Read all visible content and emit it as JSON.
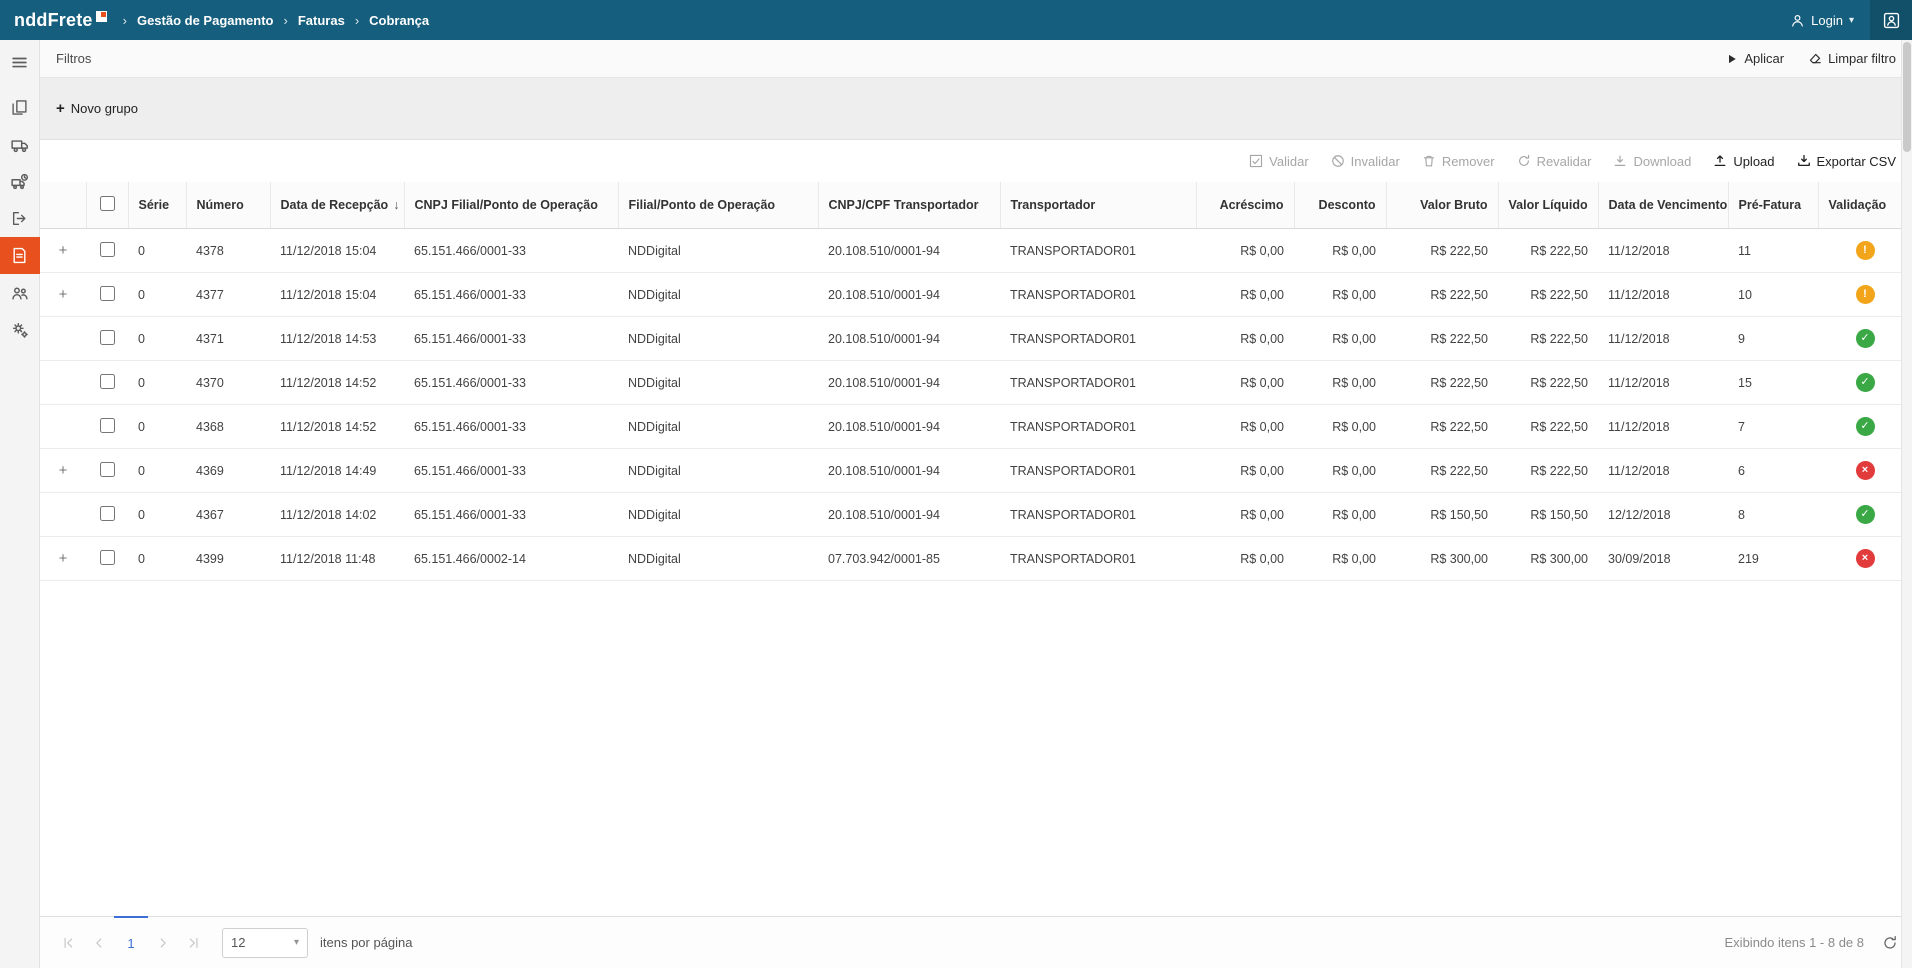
{
  "topbar": {
    "logo": "nddFrete",
    "breadcrumb": [
      "Gestão de Pagamento",
      "Faturas",
      "Cobrança"
    ],
    "login_label": "Login"
  },
  "icons": {
    "expand": "+",
    "plus": "+",
    "caret_down": "▾",
    "sort_desc": "↓",
    "breadcrumb_sep": "›"
  },
  "sidebar": {
    "items": [
      {
        "name": "menu",
        "active": false
      },
      {
        "name": "documents",
        "active": false
      },
      {
        "name": "truck",
        "active": false
      },
      {
        "name": "fleet-schedule",
        "active": false
      },
      {
        "name": "logout",
        "active": false
      },
      {
        "name": "billing",
        "active": true
      },
      {
        "name": "users",
        "active": false
      },
      {
        "name": "settings",
        "active": false
      }
    ]
  },
  "filters": {
    "title": "Filtros",
    "apply_label": "Aplicar",
    "clear_label": "Limpar filtro"
  },
  "group_panel": {
    "new_group_label": "Novo grupo"
  },
  "toolbar": {
    "buttons": [
      {
        "label": "Validar",
        "enabled": false
      },
      {
        "label": "Invalidar",
        "enabled": false
      },
      {
        "label": "Remover",
        "enabled": false
      },
      {
        "label": "Revalidar",
        "enabled": false
      },
      {
        "label": "Download",
        "enabled": false
      },
      {
        "label": "Upload",
        "enabled": true
      },
      {
        "label": "Exportar CSV",
        "enabled": true
      }
    ]
  },
  "table": {
    "columns": [
      "Série",
      "Número",
      "Data de Recepção",
      "CNPJ Filial/Ponto de Operação",
      "Filial/Ponto de Operação",
      "CNPJ/CPF Transportador",
      "Transportador",
      "Acréscimo",
      "Desconto",
      "Valor Bruto",
      "Valor Líquido",
      "Data de Vencimento",
      "Pré-Fatura",
      "Validação"
    ],
    "sorted_column": "Data de Recepção",
    "sort_direction": "desc",
    "status_glyphs": {
      "warning": "!",
      "success": "✓",
      "error": "×"
    },
    "rows": [
      {
        "expandable": true,
        "serie": "0",
        "numero": "4378",
        "recepcao": "11/12/2018 15:04",
        "cnpj_filial": "65.151.466/0001-33",
        "filial": "NDDigital",
        "cnpj_transportador": "20.108.510/0001-94",
        "transportador": "TRANSPORTADOR01",
        "acrescimo": "R$ 0,00",
        "desconto": "R$ 0,00",
        "valor_bruto": "R$ 222,50",
        "valor_liquido": "R$ 222,50",
        "vencimento": "11/12/2018",
        "pre_fatura": "11",
        "validacao": "warning"
      },
      {
        "expandable": true,
        "serie": "0",
        "numero": "4377",
        "recepcao": "11/12/2018 15:04",
        "cnpj_filial": "65.151.466/0001-33",
        "filial": "NDDigital",
        "cnpj_transportador": "20.108.510/0001-94",
        "transportador": "TRANSPORTADOR01",
        "acrescimo": "R$ 0,00",
        "desconto": "R$ 0,00",
        "valor_bruto": "R$ 222,50",
        "valor_liquido": "R$ 222,50",
        "vencimento": "11/12/2018",
        "pre_fatura": "10",
        "validacao": "warning"
      },
      {
        "expandable": false,
        "serie": "0",
        "numero": "4371",
        "recepcao": "11/12/2018 14:53",
        "cnpj_filial": "65.151.466/0001-33",
        "filial": "NDDigital",
        "cnpj_transportador": "20.108.510/0001-94",
        "transportador": "TRANSPORTADOR01",
        "acrescimo": "R$ 0,00",
        "desconto": "R$ 0,00",
        "valor_bruto": "R$ 222,50",
        "valor_liquido": "R$ 222,50",
        "vencimento": "11/12/2018",
        "pre_fatura": "9",
        "validacao": "success"
      },
      {
        "expandable": false,
        "serie": "0",
        "numero": "4370",
        "recepcao": "11/12/2018 14:52",
        "cnpj_filial": "65.151.466/0001-33",
        "filial": "NDDigital",
        "cnpj_transportador": "20.108.510/0001-94",
        "transportador": "TRANSPORTADOR01",
        "acrescimo": "R$ 0,00",
        "desconto": "R$ 0,00",
        "valor_bruto": "R$ 222,50",
        "valor_liquido": "R$ 222,50",
        "vencimento": "11/12/2018",
        "pre_fatura": "15",
        "validacao": "success"
      },
      {
        "expandable": false,
        "serie": "0",
        "numero": "4368",
        "recepcao": "11/12/2018 14:52",
        "cnpj_filial": "65.151.466/0001-33",
        "filial": "NDDigital",
        "cnpj_transportador": "20.108.510/0001-94",
        "transportador": "TRANSPORTADOR01",
        "acrescimo": "R$ 0,00",
        "desconto": "R$ 0,00",
        "valor_bruto": "R$ 222,50",
        "valor_liquido": "R$ 222,50",
        "vencimento": "11/12/2018",
        "pre_fatura": "7",
        "validacao": "success"
      },
      {
        "expandable": true,
        "serie": "0",
        "numero": "4369",
        "recepcao": "11/12/2018 14:49",
        "cnpj_filial": "65.151.466/0001-33",
        "filial": "NDDigital",
        "cnpj_transportador": "20.108.510/0001-94",
        "transportador": "TRANSPORTADOR01",
        "acrescimo": "R$ 0,00",
        "desconto": "R$ 0,00",
        "valor_bruto": "R$ 222,50",
        "valor_liquido": "R$ 222,50",
        "vencimento": "11/12/2018",
        "pre_fatura": "6",
        "validacao": "error"
      },
      {
        "expandable": false,
        "serie": "0",
        "numero": "4367",
        "recepcao": "11/12/2018 14:02",
        "cnpj_filial": "65.151.466/0001-33",
        "filial": "NDDigital",
        "cnpj_transportador": "20.108.510/0001-94",
        "transportador": "TRANSPORTADOR01",
        "acrescimo": "R$ 0,00",
        "desconto": "R$ 0,00",
        "valor_bruto": "R$ 150,50",
        "valor_liquido": "R$ 150,50",
        "vencimento": "12/12/2018",
        "pre_fatura": "8",
        "validacao": "success"
      },
      {
        "expandable": true,
        "serie": "0",
        "numero": "4399",
        "recepcao": "11/12/2018 11:48",
        "cnpj_filial": "65.151.466/0002-14",
        "filial": "NDDigital",
        "cnpj_transportador": "07.703.942/0001-85",
        "transportador": "TRANSPORTADOR01",
        "acrescimo": "R$ 0,00",
        "desconto": "R$ 0,00",
        "valor_bruto": "R$ 300,00",
        "valor_liquido": "R$ 300,00",
        "vencimento": "30/09/2018",
        "pre_fatura": "219",
        "validacao": "error"
      }
    ]
  },
  "pager": {
    "current_page": "1",
    "page_size": "12",
    "per_page_label": "itens por página",
    "summary": "Exibindo itens 1 - 8 de 8"
  }
}
